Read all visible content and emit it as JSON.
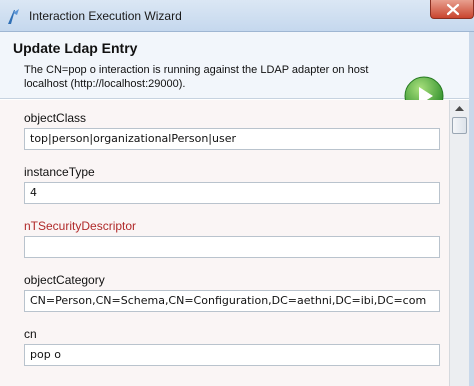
{
  "window": {
    "title": "Interaction Execution Wizard"
  },
  "header": {
    "title": "Update Ldap Entry",
    "description": "The CN=pop o interaction is running against the LDAP adapter on host localhost (http://localhost:29000)."
  },
  "fields": [
    {
      "label": "objectClass",
      "value": "top|person|organizationalPerson|user",
      "required": false
    },
    {
      "label": "instanceType",
      "value": "4",
      "required": false
    },
    {
      "label": "nTSecurityDescriptor",
      "value": "",
      "required": true
    },
    {
      "label": "objectCategory",
      "value": "CN=Person,CN=Schema,CN=Configuration,DC=aethni,DC=ibi,DC=com",
      "required": false
    },
    {
      "label": "cn",
      "value": "pop o",
      "required": false
    }
  ],
  "colors": {
    "required_label": "#b02a2a",
    "run_icon": "#3fa535"
  }
}
